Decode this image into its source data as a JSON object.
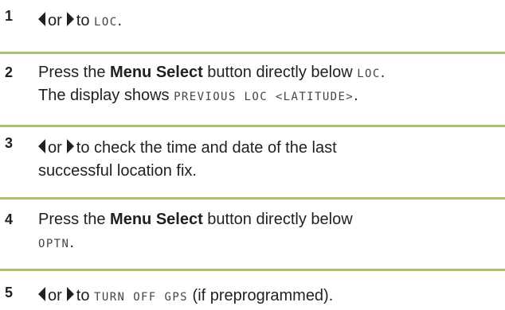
{
  "steps": [
    {
      "number": "1",
      "or_word": "or",
      "to_word": "to",
      "target": "LOC",
      "end": "."
    },
    {
      "number": "2",
      "line1_pre": "Press the ",
      "line1_bold": "Menu Select",
      "line1_post": " button directly below ",
      "line1_mono": "LOC",
      "line1_end": ".",
      "line2_pre": "The display shows ",
      "line2_mono": "PREVIOUS LOC <LATITUDE>",
      "line2_end": "."
    },
    {
      "number": "3",
      "or_word": "or",
      "line1_post": "to check the time and date of the last",
      "line2": "successful location fix."
    },
    {
      "number": "4",
      "line1_pre": "Press the ",
      "line1_bold": "Menu Select",
      "line1_post": " button directly below",
      "line2_mono": "OPTN",
      "line2_end": "."
    },
    {
      "number": "5",
      "or_word": "or",
      "to_word": "to",
      "target": "TURN OFF GPS",
      "end": " (if preprogrammed)."
    }
  ],
  "colors": {
    "text": "#231f20",
    "rule": "#a9c16a",
    "mono_text": "#444444"
  },
  "icons": [
    "left-arrow-key-icon",
    "right-arrow-key-icon"
  ]
}
